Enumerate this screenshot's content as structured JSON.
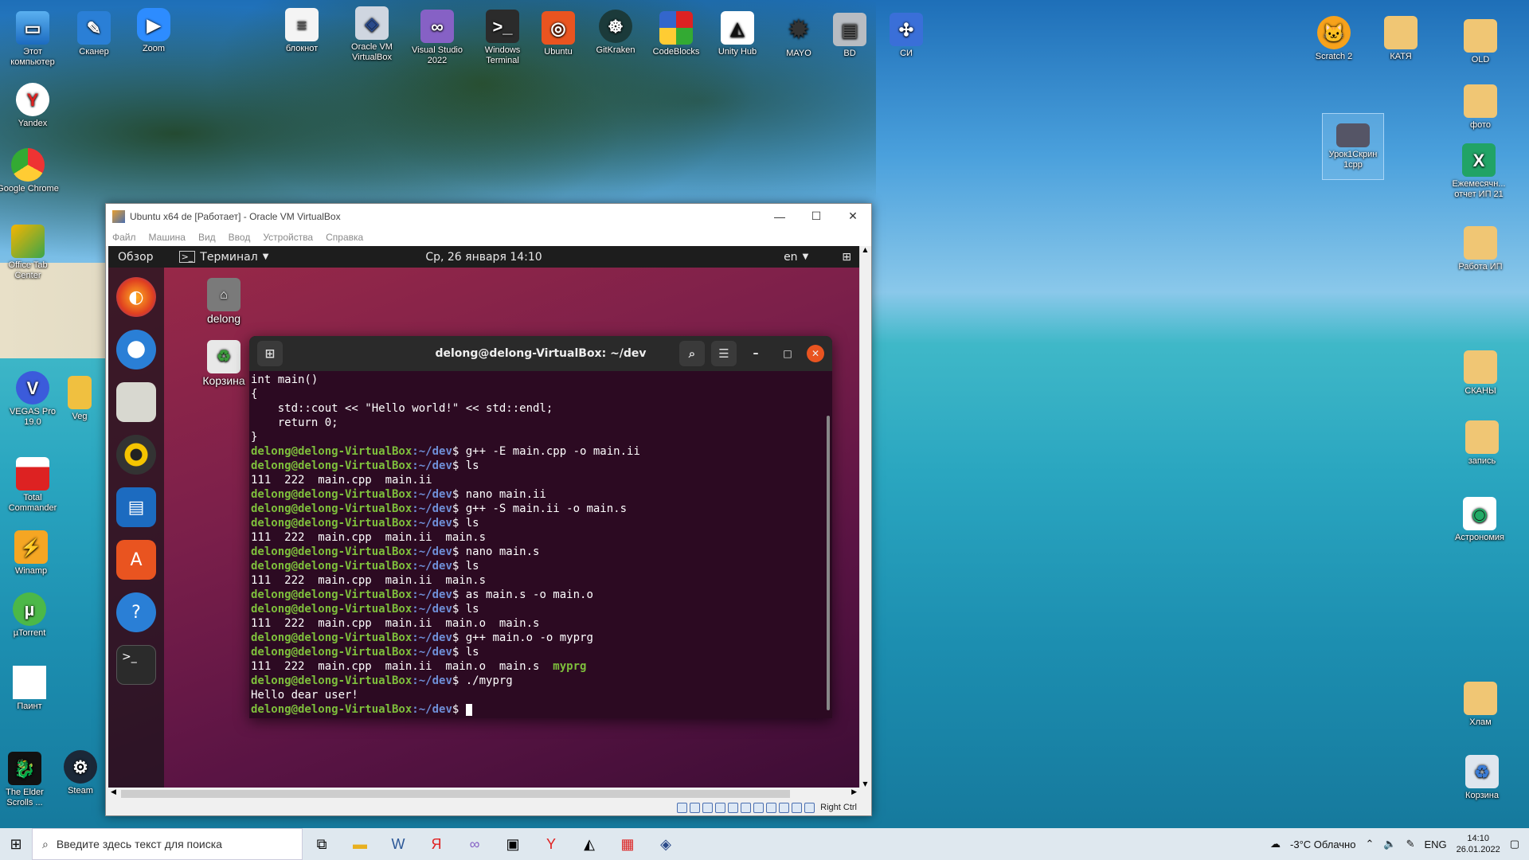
{
  "desktop": {
    "left_icons": [
      "Этот компьютер",
      "Yandex",
      "Google Chrome",
      "Office Tab Center",
      "VEGAS Pro 19.0",
      "Veg",
      "Total Commander",
      "Winamp",
      "µTorrent",
      "Паинт",
      "The Elder Scrolls ...",
      "Steam"
    ],
    "top_icons": [
      "Сканер",
      "Zoom",
      "блокнот",
      "Oracle VM VirtualBox",
      "Visual Studio 2022",
      "Windows Terminal",
      "Ubuntu",
      "GitKraken",
      "CodeBlocks",
      "Unity Hub",
      "MAYO",
      "BD",
      "СИ"
    ],
    "right_icons": [
      "Scratch 2",
      "КАТЯ",
      "OLD",
      "фото",
      "Урок1Скрин 1cpp",
      "Ежемесячн... отчет ИП 21",
      "Работа ИП",
      "СКАНЫ",
      "запись",
      "Астрономия",
      "Хлам",
      "Корзина"
    ]
  },
  "vbox": {
    "title": "Ubuntu x64 de [Работает] - Oracle VM VirtualBox",
    "menu": [
      "Файл",
      "Машина",
      "Вид",
      "Ввод",
      "Устройства",
      "Справка"
    ],
    "hostkey": "Right Ctrl"
  },
  "ubuntu": {
    "activities": "Обзор",
    "app_menu": "Терминал",
    "clock": "Ср, 26 января  14:10",
    "lang": "en",
    "desktop_icons": [
      "delong",
      "Корзина"
    ]
  },
  "terminal": {
    "title": "delong@delong-VirtualBox: ~/dev",
    "prompt_user": "delong@delong-VirtualBox",
    "prompt_path": ":~/dev",
    "code": [
      "int main()",
      "{",
      "    std::cout << \"Hello world!\" << std::endl;",
      "    return 0;",
      "}"
    ],
    "lines": [
      {
        "cmd": "g++ -E main.cpp -o main.ii"
      },
      {
        "cmd": "ls"
      },
      {
        "out": "111  222  main.cpp  main.ii"
      },
      {
        "cmd": "nano main.ii"
      },
      {
        "cmd": "g++ -S main.ii -o main.s"
      },
      {
        "cmd": "ls"
      },
      {
        "out": "111  222  main.cpp  main.ii  main.s"
      },
      {
        "cmd": "nano main.s"
      },
      {
        "cmd": "ls"
      },
      {
        "out": "111  222  main.cpp  main.ii  main.s"
      },
      {
        "cmd": "as main.s -o main.o"
      },
      {
        "cmd": "ls"
      },
      {
        "out": "111  222  main.cpp  main.ii  main.o  main.s"
      },
      {
        "cmd": "g++ main.o -o myprg"
      },
      {
        "cmd": "ls"
      },
      {
        "out": "111  222  main.cpp  main.ii  main.o  main.s  ",
        "exec": "myprg"
      },
      {
        "cmd": "./myprg"
      },
      {
        "out": "Hello dear user!"
      },
      {
        "cmd": ""
      }
    ]
  },
  "taskbar": {
    "search_placeholder": "Введите здесь текст для поиска",
    "weather": "-3°C  Облачно",
    "lang": "ENG",
    "time": "14:10",
    "date": "26.01.2022"
  }
}
